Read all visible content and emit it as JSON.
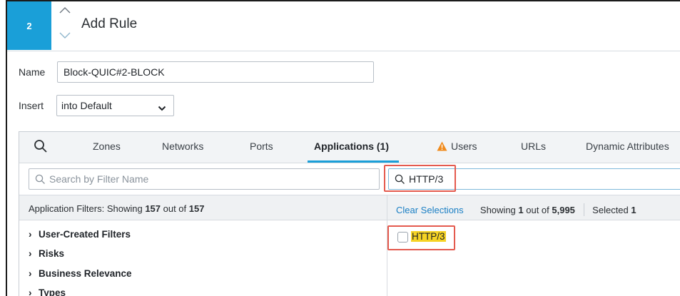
{
  "header": {
    "step_number": "2",
    "title": "Add Rule"
  },
  "form": {
    "name_label": "Name",
    "name_value": "Block-QUIC#2-BLOCK",
    "insert_label": "Insert",
    "insert_value": "into Default"
  },
  "tabs": [
    {
      "label": "Zones"
    },
    {
      "label": "Networks"
    },
    {
      "label": "Ports"
    },
    {
      "label": "Applications (1)",
      "active": true
    },
    {
      "label": "Users",
      "warning": true
    },
    {
      "label": "URLs"
    },
    {
      "label": "Dynamic Attributes"
    }
  ],
  "filters": {
    "search_placeholder": "Search by Filter Name",
    "showing_prefix": "Application Filters: Showing ",
    "showing_count": "157",
    "showing_mid": " out of ",
    "showing_total": "157",
    "items": [
      {
        "label": "User-Created Filters"
      },
      {
        "label": "Risks"
      },
      {
        "label": "Business Relevance"
      },
      {
        "label": "Types"
      }
    ]
  },
  "applications": {
    "search_value": "HTTP/3",
    "clear_label": "Clear Selections",
    "showing_prefix": "Showing ",
    "showing_count": "1",
    "showing_mid": " out of ",
    "showing_total": "5,995",
    "selected_prefix": "Selected ",
    "selected_count": "1",
    "results": [
      {
        "label": "HTTP/3",
        "checked": false
      }
    ]
  },
  "colors": {
    "accent": "#1a9fd8",
    "highlight": "#f6d324",
    "annotation": "#e45a4e",
    "warning": "#f08a1c"
  }
}
